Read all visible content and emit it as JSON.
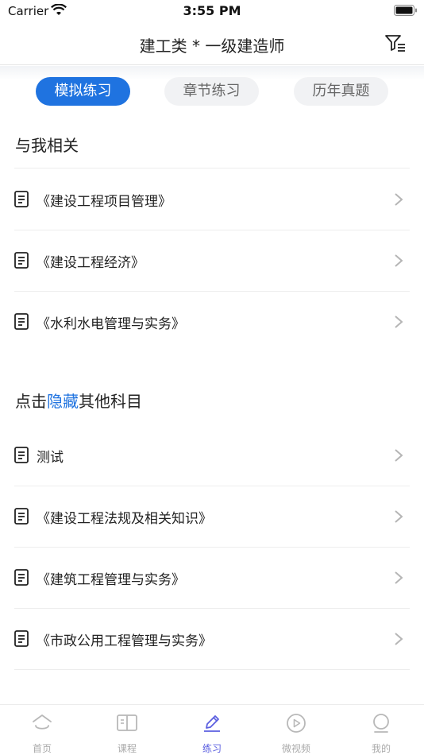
{
  "status_bar": {
    "carrier": "Carrier",
    "time": "3:55 PM"
  },
  "nav": {
    "title": "建工类 * 一级建造师"
  },
  "tabs": [
    {
      "label": "模拟练习",
      "active": true
    },
    {
      "label": "章节练习",
      "active": false
    },
    {
      "label": "历年真题",
      "active": false
    }
  ],
  "related_section": {
    "title": "与我相关",
    "items": [
      {
        "label": "《建设工程项目管理》"
      },
      {
        "label": "《建设工程经济》"
      },
      {
        "label": "《水利水电管理与实务》"
      }
    ]
  },
  "other_section": {
    "title_prefix": "点击",
    "title_link": "隐藏",
    "title_suffix": "其他科目",
    "items": [
      {
        "label": "测试"
      },
      {
        "label": "《建设工程法规及相关知识》"
      },
      {
        "label": "《建筑工程管理与实务》"
      },
      {
        "label": "《市政公用工程管理与实务》"
      }
    ]
  },
  "tab_bar": [
    {
      "label": "首页",
      "icon": "home-icon",
      "active": false
    },
    {
      "label": "课程",
      "icon": "book-icon",
      "active": false
    },
    {
      "label": "练习",
      "icon": "pencil-icon",
      "active": true
    },
    {
      "label": "微视频",
      "icon": "play-icon",
      "active": false
    },
    {
      "label": "我的",
      "icon": "user-icon",
      "active": false
    }
  ],
  "colors": {
    "accent": "#1f73e0",
    "tab_active": "#5b5fe0",
    "inactive_text": "#aaaaaa"
  }
}
